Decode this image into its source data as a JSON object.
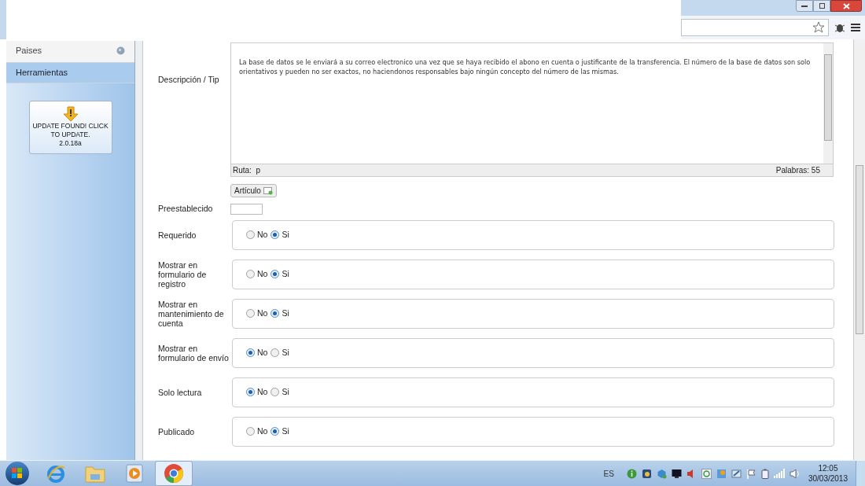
{
  "sidebar": {
    "items": [
      {
        "label": "Paises",
        "selected": false
      },
      {
        "label": "Herramientas",
        "selected": true
      }
    ],
    "update_card": {
      "message": "UPDATE FOUND! CLICK TO UPDATE.",
      "version": "2.0.18a"
    }
  },
  "form": {
    "description": {
      "label": "Descripción / Tip",
      "text": "La base de datos se le enviará a  su correo electronico una vez que se haya recibido el abono en cuenta o justificante de la transferencia. El número de la base de datos son solo orientativos y pueden no ser exactos, no haciendonos responsables bajo ningún concepto del número de las mismas.",
      "path": "Ruta:  p",
      "word_count": "Palabras: 55"
    },
    "article_button": "Artículo",
    "preset": {
      "label": "Preestablecido"
    },
    "radio_fields": [
      {
        "label": "Requerido",
        "options": [
          {
            "label": "No",
            "selected": false
          },
          {
            "label": "Si",
            "selected": true
          }
        ]
      },
      {
        "label": "Mostrar en formulario de registro",
        "options": [
          {
            "label": "No",
            "selected": false
          },
          {
            "label": "Si",
            "selected": true
          }
        ]
      },
      {
        "label": "Mostrar en mantenimiento de cuenta",
        "options": [
          {
            "label": "No",
            "selected": false
          },
          {
            "label": "Si",
            "selected": true
          }
        ]
      },
      {
        "label": "Mostrar en formulario de envío",
        "options": [
          {
            "label": "No",
            "selected": true
          },
          {
            "label": "Si",
            "selected": false
          }
        ]
      },
      {
        "label": "Solo lectura",
        "options": [
          {
            "label": "No",
            "selected": true
          },
          {
            "label": "Si",
            "selected": false
          }
        ]
      },
      {
        "label": "Publicado",
        "options": [
          {
            "label": "No",
            "selected": false
          },
          {
            "label": "Si",
            "selected": true
          }
        ]
      }
    ]
  },
  "taskbar": {
    "apps": [
      {
        "kind": "ie",
        "selected": false
      },
      {
        "kind": "folder",
        "selected": false
      },
      {
        "kind": "media",
        "selected": false
      },
      {
        "kind": "chrome",
        "selected": true
      }
    ],
    "language": "ES",
    "time": "12:05",
    "date": "30/03/2013"
  }
}
